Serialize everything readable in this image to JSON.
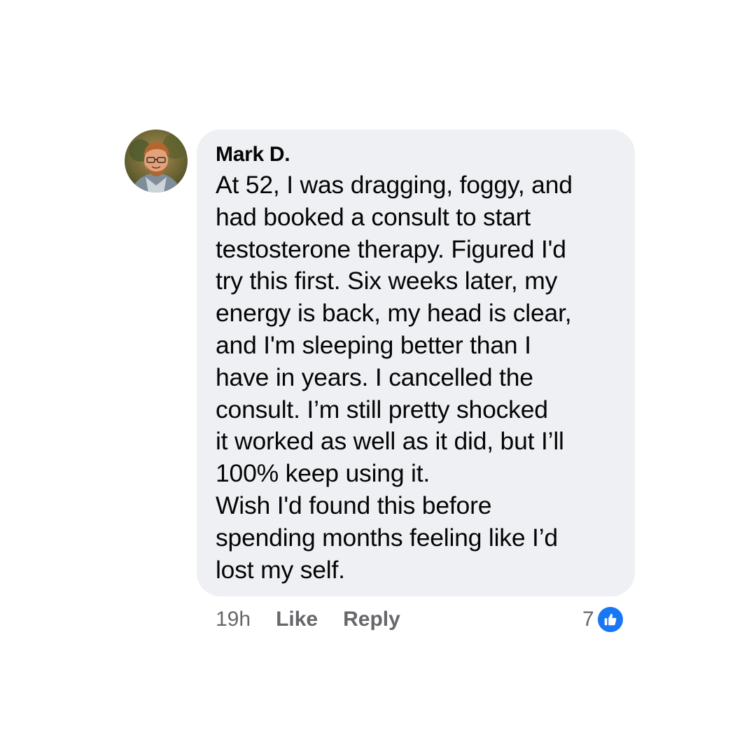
{
  "comment": {
    "author": "Mark D.",
    "lines": [
      "At 52, I was dragging, foggy, and",
      "had booked a consult to start",
      "testosterone therapy. Figured I'd",
      "try this first. Six weeks later, my",
      "energy is back, my head is clear,",
      "and I'm sleeping better than I",
      "have in years. I cancelled the",
      "consult. I’m still pretty shocked",
      "it worked as well as it did, but I’ll",
      "100% keep using it.",
      "Wish I'd found this before",
      "spending months feeling like I’d",
      "lost my self."
    ],
    "timestamp": "19h",
    "like_label": "Like",
    "reply_label": "Reply",
    "reaction_count": "7",
    "reaction_icon": "thumbs-up-icon"
  },
  "colors": {
    "bubble": "#eff0f3",
    "meta_text": "#65676b",
    "like_blue": "#1877f2"
  }
}
